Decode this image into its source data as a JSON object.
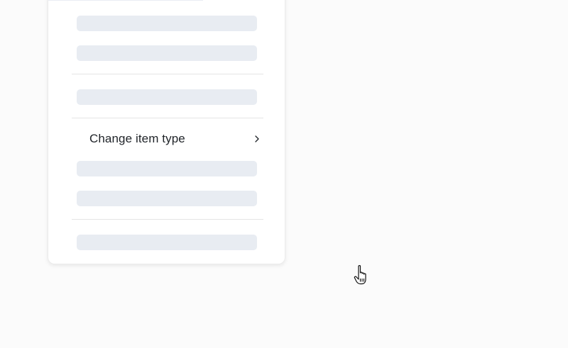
{
  "menu": {
    "items": [
      {
        "label": "Change item type",
        "has_submenu": true
      }
    ]
  },
  "icons": {
    "submenu": "chevron-right-icon",
    "pointer": "hand-pointer-cursor-icon"
  },
  "colors": {
    "skeleton": "#e8ecf2",
    "divider": "#e5e5e5",
    "text": "#1f2328",
    "background": "#fbfbfb"
  }
}
